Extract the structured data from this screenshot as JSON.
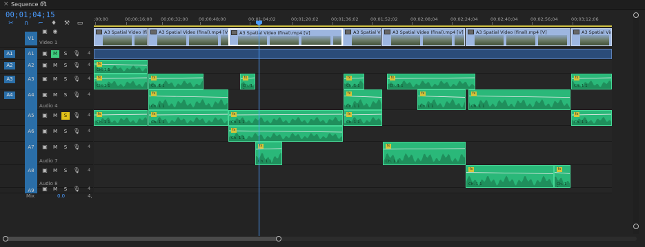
{
  "tab": {
    "close": "×",
    "title": "Sequence 01",
    "menu": "≡"
  },
  "timecode": "00;01;04;15",
  "tools": [
    "snap-icon",
    "link-icon",
    "add-marker-icon",
    "wrench-icon",
    "captions-icon"
  ],
  "ruler": {
    "labels": [
      ";00;00",
      "00;00;16;00",
      "00;00;32;00",
      "00;00;48;00",
      "00;01;04;02",
      "00;01;20;02",
      "00;01;36;02",
      "00;01;52;02",
      "00;02;08;04",
      "00;02;24;04",
      "00;02;40;04",
      "00;02;56;04",
      "00;03;12;06"
    ]
  },
  "video_track": {
    "source": "V1",
    "target": "V1",
    "name": "Video 1"
  },
  "video_clips": [
    {
      "label": "A3 Spatial Video (final).m"
    },
    {
      "label": "A3 Spatial Video (final).mp4 [V]"
    },
    {
      "label": "A3 Spatial Video (final).mp4 [V]"
    },
    {
      "label": "A3 Spatial Video (final).mp4 [V]"
    },
    {
      "label": "A3 Spatial Video (final).mp4 [V]"
    },
    {
      "label": "A3 Spatial Video (final).mp4 [V]"
    },
    {
      "label": "A3 Spatial Video"
    }
  ],
  "audio_tracks": [
    {
      "src": "A1",
      "tgt": "A1",
      "m": "M",
      "s": "S",
      "m_on": true,
      "s_on": false,
      "vol": "4",
      "name": ""
    },
    {
      "src": "A2",
      "tgt": "A2",
      "m": "M",
      "s": "S",
      "m_on": false,
      "s_on": false,
      "vol": "4",
      "name": ""
    },
    {
      "src": "A3",
      "tgt": "A3",
      "m": "M",
      "s": "S",
      "m_on": false,
      "s_on": false,
      "vol": "4",
      "name": ""
    },
    {
      "src": "A4",
      "tgt": "A4",
      "m": "M",
      "s": "S",
      "m_on": false,
      "s_on": false,
      "vol": "4",
      "name": "Audio 4"
    },
    {
      "src": "",
      "tgt": "A5",
      "m": "M",
      "s": "S",
      "m_on": false,
      "s_on": true,
      "vol": "4",
      "name": ""
    },
    {
      "src": "",
      "tgt": "A6",
      "m": "M",
      "s": "S",
      "m_on": false,
      "s_on": false,
      "vol": "4",
      "name": ""
    },
    {
      "src": "",
      "tgt": "A7",
      "m": "M",
      "s": "S",
      "m_on": false,
      "s_on": false,
      "vol": "4",
      "name": "Audio 7"
    },
    {
      "src": "",
      "tgt": "A8",
      "m": "M",
      "s": "S",
      "m_on": false,
      "s_on": false,
      "vol": "4",
      "name": "Audio 8"
    },
    {
      "src": "",
      "tgt": "A9",
      "m": "M",
      "s": "S",
      "m_on": false,
      "s_on": false,
      "vol": "4",
      "name": ""
    }
  ],
  "mix": {
    "label": "Mix",
    "value": "0.0",
    "end": "4,"
  },
  "clip_gain_label": "Ch. 1 1",
  "colors": {
    "accent": "#4a9cff",
    "audio_clip": "#2ab879",
    "video_clip": "#9db6e0",
    "mute_on": "#3ecb7e",
    "solo_on": "#e3c21a"
  }
}
